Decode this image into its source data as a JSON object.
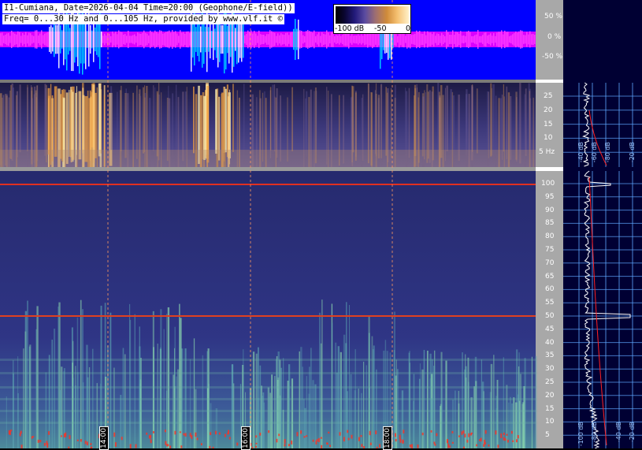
{
  "header": {
    "line1": "I1-Cumiana, Date=2026-04-04 Time=20:00 (Geophone/E-field))",
    "line2": "Freq= 0...30 Hz and 0...105 Hz, provided by www.vlf.it ©"
  },
  "colorbar": {
    "label_min": "-100 dB",
    "label_mid": "-50",
    "label_max": "0"
  },
  "amplitude_axis": {
    "ticks": [
      "50 %",
      "0 %",
      "-50 %"
    ]
  },
  "low_freq_axis": {
    "ticks": [
      "25",
      "20",
      "15",
      "10",
      "5 Hz"
    ]
  },
  "high_freq_axis": {
    "ticks": [
      "100",
      "95",
      "90",
      "85",
      "80",
      "75",
      "70",
      "65",
      "60",
      "55",
      "50",
      "45",
      "40",
      "35",
      "30",
      "25",
      "20",
      "15",
      "10",
      "5"
    ]
  },
  "time_markers": [
    "14:00",
    "16:00",
    "18:00"
  ],
  "spectrum_panel": {
    "bp_labels_upper": [
      "-40 dB",
      "-60 dB",
      "-80 dB",
      "-20 dB"
    ],
    "bp_labels_lower": [
      "-100 dB",
      "-80 dB",
      "-40 dB",
      "-20 dB"
    ]
  },
  "colors": {
    "amplitude_bg": "#0000ff",
    "amplitude_trace": "#ff00ff",
    "spectrogram_base": "#2b2f7e",
    "side_panel_bg": "#000033",
    "grid_line": "#5fa8ff",
    "red_curve": "#ff2020"
  }
}
